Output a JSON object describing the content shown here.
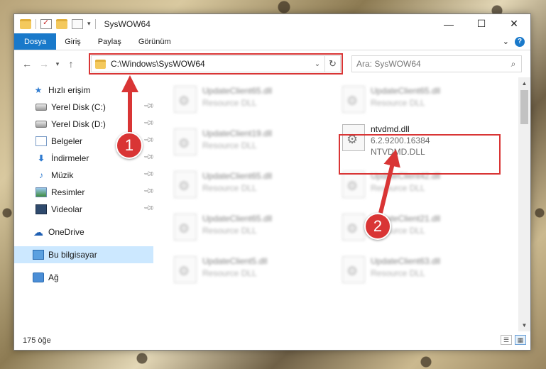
{
  "window": {
    "title": "SysWOW64",
    "minimize": "—",
    "maximize": "☐",
    "close": "✕"
  },
  "ribbon": {
    "tabs": [
      {
        "label": "Dosya"
      },
      {
        "label": "Giriş"
      },
      {
        "label": "Paylaş"
      },
      {
        "label": "Görünüm"
      }
    ],
    "help": "?"
  },
  "nav": {
    "address": "C:\\Windows\\SysWOW64",
    "search_placeholder": "Ara: SysWOW64"
  },
  "sidebar": {
    "items": [
      {
        "label": "Hızlı erişim",
        "icon": "star-icon"
      },
      {
        "label": "Yerel Disk (C:)",
        "icon": "drive-icon"
      },
      {
        "label": "Yerel Disk (D:)",
        "icon": "drive-icon"
      },
      {
        "label": "Belgeler",
        "icon": "documents-icon"
      },
      {
        "label": "İndirmeler",
        "icon": "download-icon"
      },
      {
        "label": "Müzik",
        "icon": "music-icon"
      },
      {
        "label": "Resimler",
        "icon": "pictures-icon"
      },
      {
        "label": "Videolar",
        "icon": "videos-icon"
      },
      {
        "label": "OneDrive",
        "icon": "cloud-icon"
      },
      {
        "label": "Bu bilgisayar",
        "icon": "computer-icon"
      },
      {
        "label": "Ağ",
        "icon": "network-icon"
      }
    ]
  },
  "files": {
    "blurred": [
      {
        "name": "UpdateClient65.dll",
        "meta": "Resource DLL"
      },
      {
        "name": "UpdateClient65.dll",
        "meta": "Resource DLL"
      },
      {
        "name": "UpdateClient19.dll",
        "meta": "Resource DLL"
      },
      {
        "name": "UpdateClient65.dll",
        "meta": "Resource DLL"
      },
      {
        "name": "UpdateClient42.dll",
        "meta": "Resource DLL"
      },
      {
        "name": "UpdateClient65.dll",
        "meta": "Resource DLL"
      },
      {
        "name": "UpdateClient21.dll",
        "meta": "Resource DLL"
      },
      {
        "name": "UpdateClient5.dll",
        "meta": "Resource DLL"
      },
      {
        "name": "UpdateClient63.dll",
        "meta": "Resource DLL"
      }
    ],
    "target": {
      "name": "ntvdmd.dll",
      "version": "6.2.9200.16384",
      "description": "NTVDMD.DLL"
    }
  },
  "status": {
    "count": "175 öğe"
  },
  "annotations": {
    "step1": "1",
    "step2": "2",
    "color": "#d93535"
  }
}
